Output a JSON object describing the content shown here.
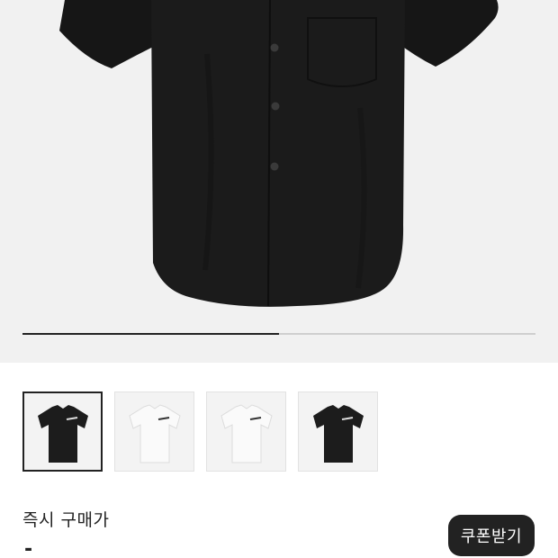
{
  "product": {
    "gallery": {
      "image_name": "black-short-sleeve-shirt",
      "progress": 0.5,
      "background_color": "#f1f1f1"
    },
    "thumbnails": [
      {
        "name": "black-shirt-front",
        "color": "#1c1c1c",
        "selected": true
      },
      {
        "name": "white-shirt-front",
        "color": "#f4f4f4",
        "selected": false
      },
      {
        "name": "white-shirt-front-2",
        "color": "#f4f4f4",
        "selected": false
      },
      {
        "name": "black-shirt-front-2",
        "color": "#1c1c1c",
        "selected": false
      }
    ],
    "price_label": "즉시 구매가",
    "price_value": "-"
  },
  "coupon_button": {
    "label": "쿠폰받기",
    "background": "#222222",
    "text_color": "#ffffff"
  }
}
